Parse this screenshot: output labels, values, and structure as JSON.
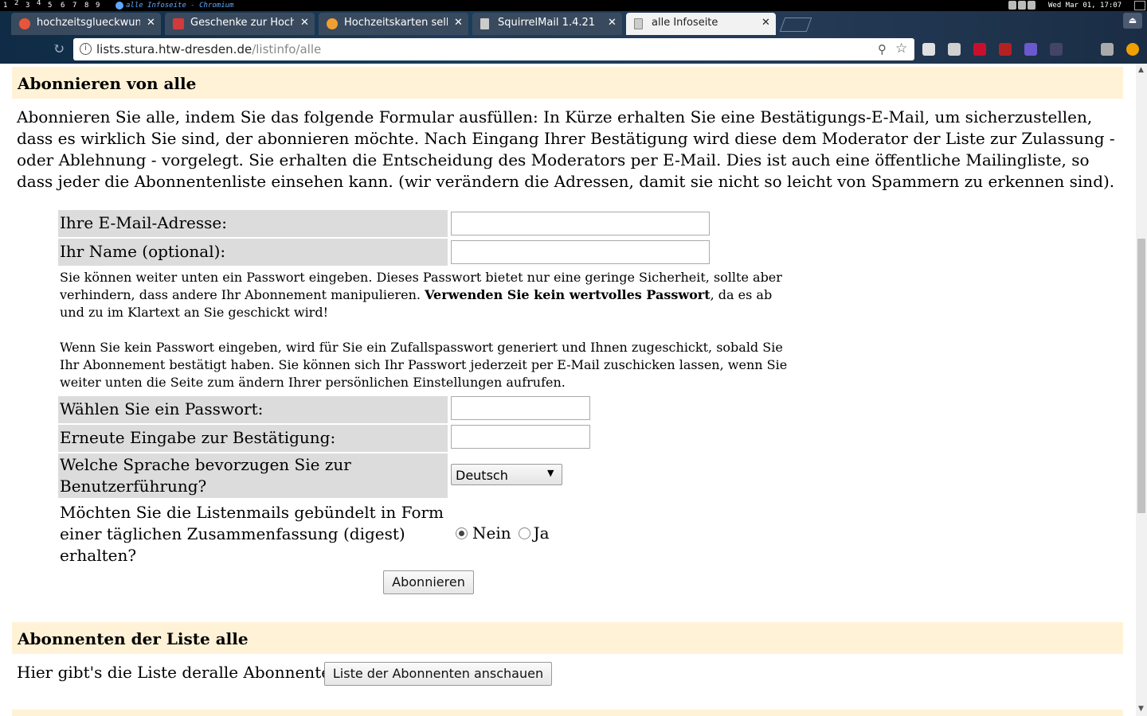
{
  "system": {
    "workspaces": [
      "1",
      "2",
      "3",
      "4",
      "5",
      "6",
      "7",
      "8",
      "9"
    ],
    "window_title": "alle Infoseite - Chromium",
    "clock": "Wed Mar 01, 17:07"
  },
  "tabs": [
    {
      "label": "hochzeitsglueckwunsch",
      "icon_color": "#e8553a",
      "active": false
    },
    {
      "label": "Geschenke zur Hochzeit",
      "icon_color": "#d23b3b",
      "active": false
    },
    {
      "label": "Hochzeitskarten selbe",
      "icon_color": "#f0a030",
      "active": false
    },
    {
      "label": "SquirrelMail 1.4.21",
      "icon_color": "#cccccc",
      "active": false
    },
    {
      "label": "alle Infoseite",
      "icon_color": "#cccccc",
      "active": true
    }
  ],
  "omnibox": {
    "host": "lists.stura.htw-dresden.de",
    "path": "/listinfo/alle"
  },
  "extensions": [
    "#e0e0e0",
    "#d0d0d0",
    "#c8102e",
    "#b22222",
    "#6a5acd",
    "#444466",
    "#aaaaaa",
    "#f0a000"
  ],
  "subscribe": {
    "header": "Abonnieren von alle",
    "intro": "Abonnieren Sie alle, indem Sie das folgende Formular ausfüllen: In Kürze erhalten Sie eine Bestätigungs-E-Mail, um sicherzustellen, dass es wirklich Sie sind, der abonnieren möchte. Nach Eingang Ihrer Bestätigung wird diese dem Moderator der Liste zur Zulassung - oder Ablehnung - vorgelegt. Sie erhalten die Entscheidung des Moderators per E-Mail. Dies ist auch eine öffentliche Mailingliste, so dass jeder die Abonnentenliste einsehen kann. (wir verändern die Adressen, damit sie nicht so leicht von Spammern zu erkennen sind).",
    "email_label": "Ihre E-Mail-Adresse:",
    "email_value": "",
    "name_label": "Ihr Name (optional):",
    "name_value": "",
    "note1_a": "Sie können weiter unten ein Passwort eingeben. Dieses Passwort bietet nur eine geringe Sicherheit, sollte aber verhindern, dass andere Ihr Abonnement manipulieren. ",
    "note1_bold": "Verwenden Sie kein wertvolles Passwort",
    "note1_b": ", da es ab und zu im Klartext an Sie geschickt wird!",
    "note2": "Wenn Sie kein Passwort eingeben, wird für Sie ein Zufallspasswort generiert und Ihnen zugeschickt, sobald Sie Ihr Abonnement bestätigt haben. Sie können sich Ihr Passwort jederzeit per E-Mail zuschicken lassen, wenn Sie weiter unten die Seite zum ändern Ihrer persönlichen Einstellungen aufrufen.",
    "password_label": "Wählen Sie ein Passwort:",
    "confirm_label": "Erneute Eingabe zur Bestätigung:",
    "language_label": "Welche Sprache bevorzugen Sie zur Benutzerführung?",
    "language_value": "Deutsch",
    "digest_label": "Möchten Sie die Listenmails gebündelt in Form einer täglichen Zusammenfassung (digest) erhalten?",
    "digest_no": "Nein",
    "digest_yes": "Ja",
    "digest_selected": "Nein",
    "submit_label": "Abonnieren"
  },
  "subscribers": {
    "header": "Abonnenten der Liste alle",
    "text": "Hier gibt's die Liste deralle Abonnenten:",
    "button_label": "Liste der Abonnenten anschauen"
  }
}
